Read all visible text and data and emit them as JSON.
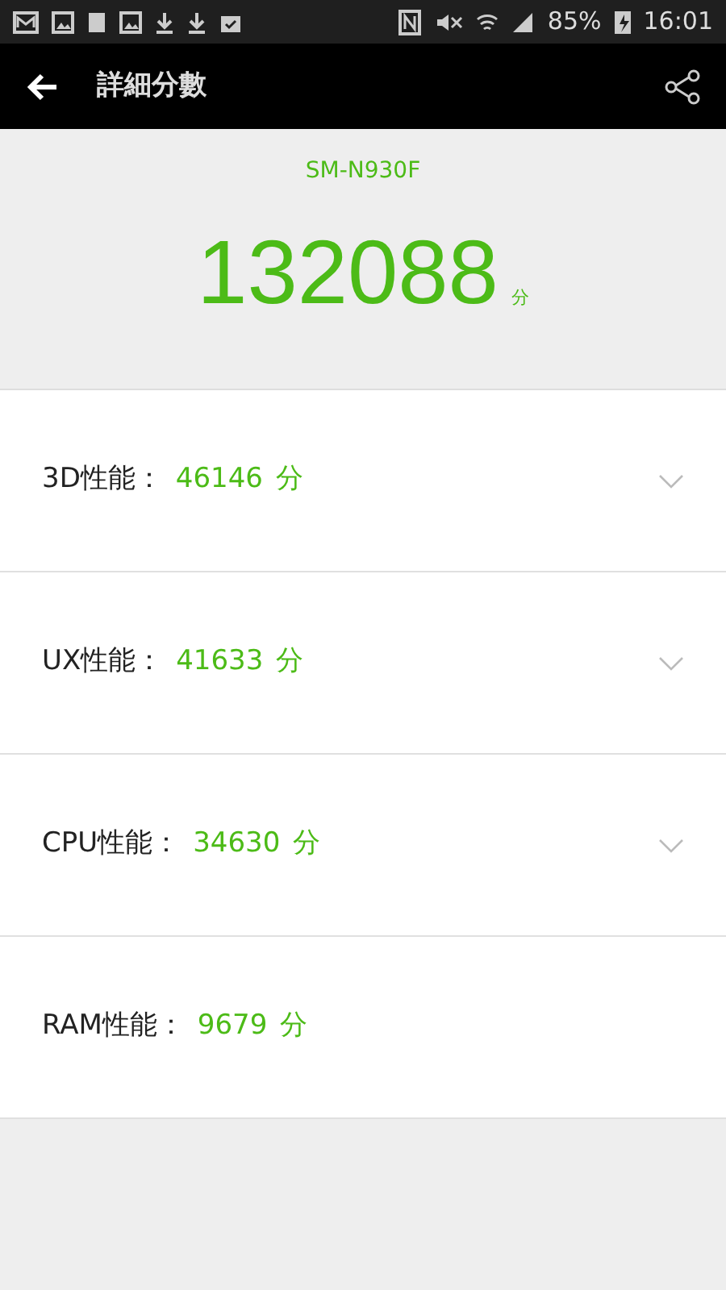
{
  "status_bar": {
    "battery": "85%",
    "time": "16:01"
  },
  "app_bar": {
    "title": "詳細分數"
  },
  "summary": {
    "device": "SM-N930F",
    "score": "132088",
    "unit": "分"
  },
  "rows": [
    {
      "label": "3D性能：",
      "score": "46146",
      "unit": "分",
      "expandable": true
    },
    {
      "label": "UX性能：",
      "score": "41633",
      "unit": "分",
      "expandable": true
    },
    {
      "label": "CPU性能：",
      "score": "34630",
      "unit": "分",
      "expandable": true
    },
    {
      "label": "RAM性能：",
      "score": "9679",
      "unit": "分",
      "expandable": false
    }
  ]
}
